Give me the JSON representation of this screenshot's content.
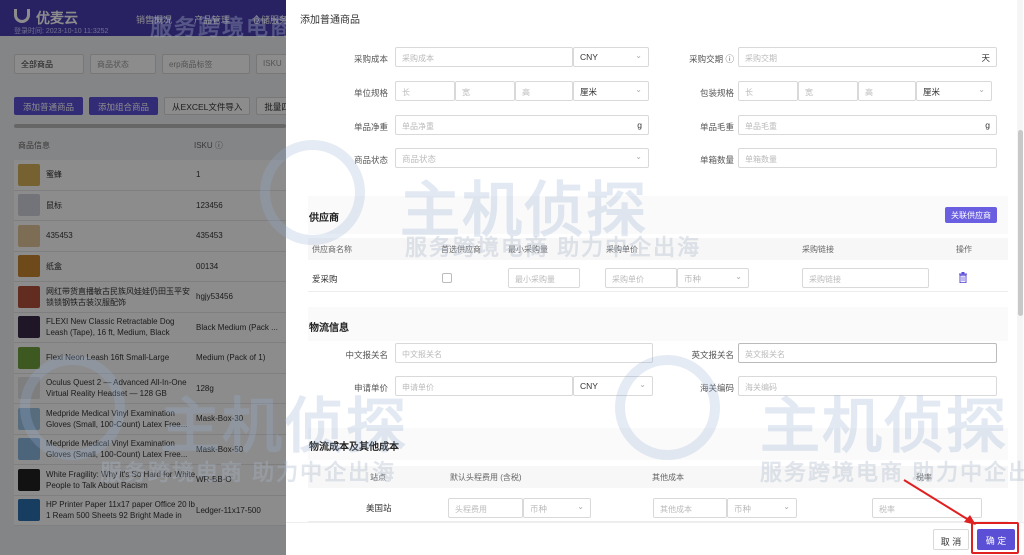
{
  "app": {
    "logo_text": "优麦云",
    "time_text": "登录时间: 2023-10-10 11:3252",
    "nav": [
      "销售概况",
      "产品管理",
      "仓储服务"
    ],
    "filters": [
      "全部商品",
      "商品状态",
      "erp商品标签",
      "ISKU"
    ],
    "actions": [
      "添加普通商品",
      "添加组合商品",
      "从EXCEL文件导入",
      "批量四"
    ],
    "table_headers": [
      "商品信息",
      "ISKU ⓘ"
    ],
    "products": [
      {
        "name": "蜜蜂",
        "sku": "1",
        "color": "#d8b25a"
      },
      {
        "name": "鼠标",
        "sku": "123456",
        "color": "#cfd4dc"
      },
      {
        "name": "435453",
        "sku": "435453",
        "color": "#e2c79a"
      },
      {
        "name": "纸盒",
        "sku": "00134",
        "color": "#c9852e"
      },
      {
        "name": "网红带货直播敏古民族风娃娃仍田玉平安锁锁钢铁古装汉服配饰",
        "sku": "hgjy53456",
        "color": "#b3503c"
      },
      {
        "name": "FLEXI New Classic Retractable Dog Leash (Tape), 16 ft, Medium, Black",
        "sku": "Black Medium (Pack ...",
        "color": "#3a2a4a"
      },
      {
        "name": "Flexi Neon Leash 16ft Small-Large",
        "sku": "Medium (Pack of 1)",
        "color": "#6fa33c"
      },
      {
        "name": "Oculus Quest 2 — Advanced All-In-One Virtual Reality Headset — 128 GB",
        "sku": "128g",
        "color": "#e6e6e6"
      },
      {
        "name": "Medpride Medical Vinyl Examination Gloves (Small, 100-Count) Latex Free...",
        "sku": "Mask-Box-30",
        "color": "#9fc6e6"
      },
      {
        "name": "Medpride Medical Vinyl Examination Gloves (Small, 100-Count) Latex Free...",
        "sku": "Mask-Box-50",
        "color": "#8ab8de"
      },
      {
        "name": "White Fragility: Why It's So Hard for White People to Talk About Racism",
        "sku": "WR-BB-O",
        "color": "#222222"
      },
      {
        "name": "HP Printer Paper 11x17 paper Office 20 lb 1 Ream 500 Sheets 92 Bright Made in",
        "sku": "Ledger-11x17-500",
        "color": "#2a6fb0"
      }
    ]
  },
  "drawer": {
    "title": "添加普通商品",
    "basic": {
      "purchase_cost_label": "采购成本",
      "purchase_cost_ph": "采购成本",
      "currency": "CNY",
      "lead_time_label": "采购交期 ⓘ",
      "lead_time_ph": "采购交期",
      "lead_time_unit": "天",
      "unit_spec_label": "单位规格",
      "pack_spec_label": "包装规格",
      "dim_l": "长",
      "dim_w": "宽",
      "dim_h": "高",
      "dim_unit": "厘米",
      "net_weight_label": "单品净重",
      "net_weight_ph": "单品净重",
      "gross_weight_label": "单品毛重",
      "gross_weight_ph": "单品毛重",
      "weight_unit": "g",
      "status_label": "商品状态",
      "status_ph": "商品状态",
      "box_qty_label": "单箱数量",
      "box_qty_ph": "单箱数量"
    },
    "supplier": {
      "title": "供应商",
      "link_button": "关联供应商",
      "headers": [
        "供应商名称",
        "首选供应商",
        "最小采购量",
        "采购单价",
        "采购链接",
        "操作"
      ],
      "row": {
        "name": "爱采购",
        "min_qty_ph": "最小采购量",
        "price_ph": "采购单价",
        "currency_ph": "币种",
        "link_ph": "采购链接"
      }
    },
    "logistics": {
      "title": "物流信息",
      "cn_name_label": "中文报关名",
      "cn_name_ph": "中文报关名",
      "en_name_label": "英文报关名",
      "en_name_ph": "英文报关名",
      "declare_price_label": "申请单价",
      "declare_price_ph": "申请单价",
      "currency": "CNY",
      "hs_code_label": "海关编码",
      "hs_code_ph": "海关编码"
    },
    "costs": {
      "title": "物流成本及其他成本",
      "headers": [
        "站点",
        "默认头程费用 (含税)",
        "其他成本",
        "税率"
      ],
      "row": {
        "site": "美国站",
        "first_leg_ph": "头程费用",
        "currency_ph": "币种",
        "other_ph": "其他成本",
        "tax_ph": "税率"
      }
    },
    "footer": {
      "cancel": "取 消",
      "confirm": "确 定"
    }
  },
  "watermarks": {
    "tagline": "服务跨境电商  助力中企出海",
    "brand": "主机侦探"
  }
}
